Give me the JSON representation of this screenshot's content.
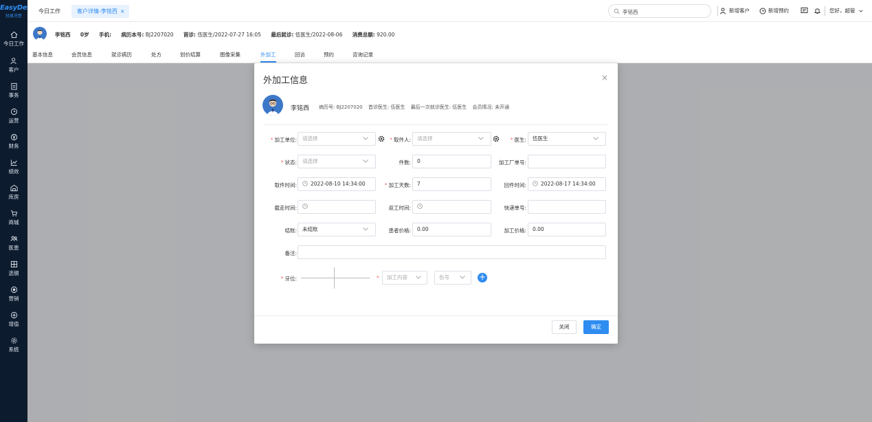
{
  "brand": {
    "name": "EasyDent",
    "sub": "轻易牙医"
  },
  "sidebar": {
    "items": [
      {
        "label": "今日工作",
        "icon": "home-icon"
      },
      {
        "label": "客户",
        "icon": "user-icon"
      },
      {
        "label": "事务",
        "icon": "clipboard-icon"
      },
      {
        "label": "运营",
        "icon": "clock-icon"
      },
      {
        "label": "财务",
        "icon": "yen-icon"
      },
      {
        "label": "绩效",
        "icon": "chart-icon"
      },
      {
        "label": "库房",
        "icon": "warehouse-icon"
      },
      {
        "label": "商城",
        "icon": "cart-icon"
      },
      {
        "label": "医患",
        "icon": "people-icon"
      },
      {
        "label": "选钢",
        "icon": "grid-icon"
      },
      {
        "label": "营销",
        "icon": "target-icon"
      },
      {
        "label": "增值",
        "icon": "plus-circle-icon"
      },
      {
        "label": "系统",
        "icon": "gear-icon"
      }
    ]
  },
  "topbar": {
    "home_tab": "今日工作",
    "active_tab": "客户详情-李铭西",
    "active_tab_close": "×",
    "search_value": "李铭西",
    "new_customer": "新增客户",
    "new_appointment": "新增预约",
    "greeting": "您好，超管"
  },
  "patient": {
    "name": "李铭西",
    "age": "0岁",
    "phone_label": "手机:",
    "record_label": "病历本号:",
    "record_no": "BJ2207020",
    "first_visit_label": "首诊:",
    "first_visit": "伍医生/2022-07-27 16:05",
    "last_visit_label": "最后就诊:",
    "last_visit": "伍医生/2022-08-06",
    "total_label": "消费总额:",
    "total": "920.00"
  },
  "subtabs": [
    "基本信息",
    "会员信息",
    "就诊病历",
    "处方",
    "划价结算",
    "图像采集",
    "外加工",
    "回访",
    "预约",
    "咨询记录"
  ],
  "modal": {
    "title": "外加工信息",
    "close": "×",
    "patient_name": "李铭西",
    "meta": [
      "病历号: BJ2207020",
      "首诊医生: 伍医生",
      "最后一次就诊医生: 伍医生",
      "会员情况: 未开通"
    ],
    "fields": {
      "unit_label": "加工单位:",
      "unit_ph": "请选择",
      "pickup_person_label": "取件人:",
      "pickup_person_ph": "请选择",
      "doctor_label": "医生:",
      "doctor_value": "伍医生",
      "status_label": "状态:",
      "status_ph": "请选择",
      "count_label": "件数:",
      "count_value": "0",
      "factory_no_label": "加工厂单号:",
      "pickup_time_label": "取件时间:",
      "pickup_time_value": "2022-08-10 14:34:00",
      "days_label": "加工天数:",
      "days_value": "7",
      "return_time_label": "回件时间:",
      "return_time_value": "2022-08-17 14:34:00",
      "send_time_label": "截走时间:",
      "back_time_label": "返工时间:",
      "express_label": "快递单号:",
      "settle_label": "结账:",
      "settle_value": "未结账",
      "patient_price_label": "患者价格:",
      "patient_price_value": "0.00",
      "process_price_label": "加工价格:",
      "process_price_value": "0.00",
      "remark_label": "备注:",
      "tooth_label": "牙位:",
      "content_ph": "加工内容",
      "color_ph": "色号",
      "add": "+"
    },
    "cancel": "关闭",
    "ok": "确定"
  }
}
